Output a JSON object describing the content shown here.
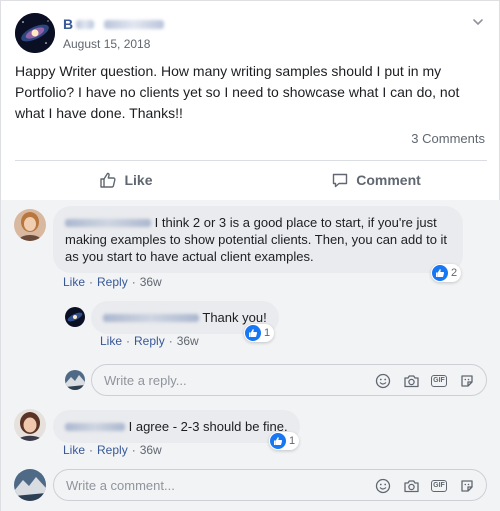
{
  "post": {
    "author_visible": "B",
    "date": "August 15, 2018",
    "text": "Happy Writer question. How many writing samples should I put in my Portfolio? I have no clients yet so I need to showcase what I can do, not what I have done. Thanks!!",
    "comments_count": "3 Comments"
  },
  "actions": {
    "like": "Like",
    "comment": "Comment"
  },
  "comments": [
    {
      "text": "I think 2 or 3 is a good place to start, if you're just making examples to show potential clients. Then, you can add to it as you start to have actual client examples.",
      "like_label": "Like",
      "reply_label": "Reply",
      "time": "36w",
      "reactions": "2"
    },
    {
      "text": "Thank you!",
      "like_label": "Like",
      "reply_label": "Reply",
      "time": "36w",
      "reactions": "1"
    },
    {
      "text": "I agree - 2-3 should be fine.",
      "like_label": "Like",
      "reply_label": "Reply",
      "time": "36w",
      "reactions": "1"
    }
  ],
  "reply_input": {
    "placeholder": "Write a reply..."
  },
  "comment_input": {
    "placeholder": "Write a comment..."
  },
  "separator": "·",
  "gif_label": "GIF",
  "colors": {
    "link": "#385898",
    "like_blue": "#1877f2",
    "bubble": "#e9ebee",
    "muted": "#606770"
  }
}
